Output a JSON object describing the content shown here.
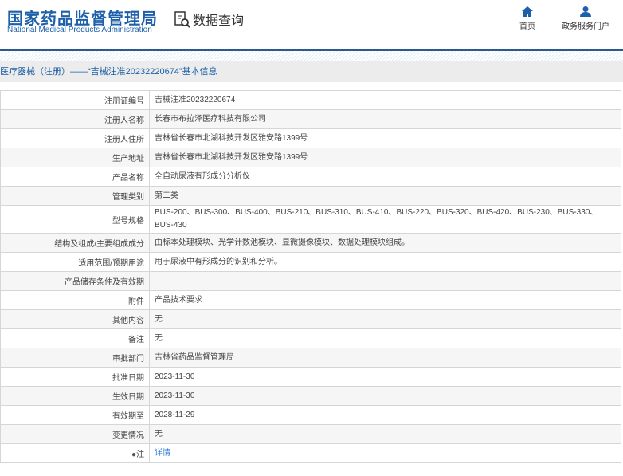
{
  "header": {
    "logo_cn": "国家药品监督管理局",
    "logo_en": "National Medical Products Administration",
    "query": "数据查询",
    "nav": [
      {
        "label": "首页",
        "icon": "home-icon"
      },
      {
        "label": "政务服务门户",
        "icon": "user-icon"
      }
    ]
  },
  "breadcrumb": "医疗器械（注册）——“吉械注准20232220674”基本信息",
  "rows": [
    {
      "label": "注册证编号",
      "value": "吉械注准20232220674"
    },
    {
      "label": "注册人名称",
      "value": "长春市布拉泽医疗科技有限公司"
    },
    {
      "label": "注册人住所",
      "value": "吉林省长春市北湖科技开发区雅安路1399号"
    },
    {
      "label": "生产地址",
      "value": "吉林省长春市北湖科技开发区雅安路1399号"
    },
    {
      "label": "产品名称",
      "value": "全自动尿液有形成分分析仪"
    },
    {
      "label": "管理类别",
      "value": "第二类"
    },
    {
      "label": "型号规格",
      "value": "BUS-200、BUS-300、BUS-400、BUS-210、BUS-310、BUS-410、BUS-220、BUS-320、BUS-420、BUS-230、BUS-330、BUS-430"
    },
    {
      "label": "结构及组成/主要组成成分",
      "value": "由标本处理模块、光学计数池模块、显微摄像模块、数据处理模块组成。"
    },
    {
      "label": "适用范围/预期用途",
      "value": "用于尿液中有形成分的识别和分析。"
    },
    {
      "label": "产品储存条件及有效期",
      "value": ""
    },
    {
      "label": "附件",
      "value": "产品技术要求"
    },
    {
      "label": "其他内容",
      "value": "无"
    },
    {
      "label": "备注",
      "value": "无"
    },
    {
      "label": "审批部门",
      "value": "吉林省药品监督管理局"
    },
    {
      "label": "批准日期",
      "value": "2023-11-30"
    },
    {
      "label": "生效日期",
      "value": "2023-11-30"
    },
    {
      "label": "有效期至",
      "value": "2028-11-29"
    },
    {
      "label": "变更情况",
      "value": "无"
    }
  ],
  "note": {
    "label": "注",
    "link": "详情"
  }
}
